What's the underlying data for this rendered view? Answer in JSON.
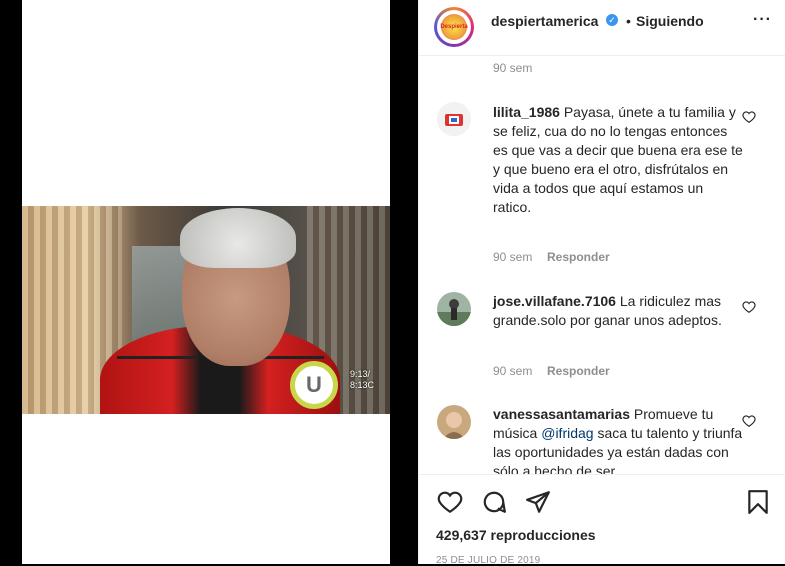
{
  "header": {
    "username": "despiertamerica",
    "verified_glyph": "✓",
    "separator": "•",
    "follow_status": "Siguiendo",
    "more_glyph": "···",
    "avatar_label": "Despierta"
  },
  "video": {
    "overlay_time": "9:13/",
    "overlay_temp": "8:13C",
    "badge_glyph": "U"
  },
  "comments": [
    {
      "username": "",
      "text": "",
      "time": "90 sem",
      "reply": ""
    },
    {
      "username": "lilita_1986",
      "text": "Payasa, únete a tu familia y se feliz, cua do no lo tengas entonces es que vas a decir que buena era ese te y que bueno era el otro, disfrútalos en vida a todos que aquí estamos un ratico.",
      "time": "90 sem",
      "reply": "Responder"
    },
    {
      "username": "jose.villafane.7106",
      "text": "La ridiculez mas grande.solo por ganar unos adeptos.",
      "time": "90 sem",
      "reply": "Responder"
    },
    {
      "username": "vanessasantamarias",
      "text_before": "Promueve tu música ",
      "mention": "@ifridag",
      "text_after": " saca tu talento y triunfa las oportunidades ya están dadas con sólo a hecho de ser"
    }
  ],
  "footer": {
    "views": "429,637 reproducciones",
    "date": "25 DE JULIO DE 2019"
  },
  "colors": {
    "verified": "#3897f0",
    "secondary_text": "#8e8e8e",
    "mention": "#00376b"
  }
}
